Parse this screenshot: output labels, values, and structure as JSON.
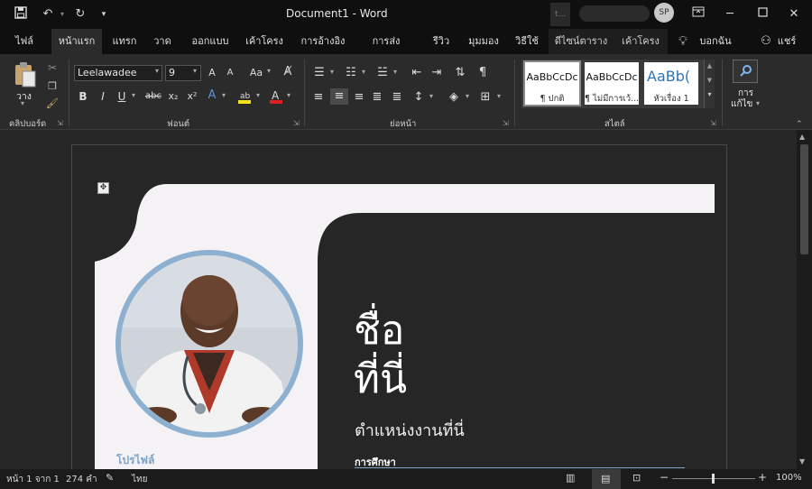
{
  "titlebar": {
    "doc_title": "Document1  -  Word",
    "account_initials": "SP",
    "account_hint": "t..."
  },
  "tabs": [
    {
      "label": "ไฟล์"
    },
    {
      "label": "หน้าแรก"
    },
    {
      "label": "แทรก"
    },
    {
      "label": "วาด"
    },
    {
      "label": "ออกแบบ"
    },
    {
      "label": "เค้าโครง"
    },
    {
      "label": "การอ้างอิง"
    },
    {
      "label": "การส่งจดหมาย"
    },
    {
      "label": "รีวิว"
    },
    {
      "label": "มุมมอง"
    },
    {
      "label": "วิธีใช้"
    },
    {
      "label": "ดีไซน์ตาราง"
    },
    {
      "label": "เค้าโครง"
    }
  ],
  "tell_me": "บอกฉัน",
  "share": "แชร์",
  "ribbon": {
    "clipboard": {
      "paste_label": "วาง",
      "group_label": "คลิปบอร์ด"
    },
    "font": {
      "font_name": "Leelawadee",
      "font_size": "9",
      "change_case": "Aa",
      "group_label": "ฟอนต์"
    },
    "paragraph": {
      "group_label": "ย่อหน้า"
    },
    "styles": {
      "group_label": "สไตล์",
      "items": [
        {
          "sample": "AaBbCcDc",
          "name": "¶ ปกติ"
        },
        {
          "sample": "AaBbCcDc",
          "name": "¶ ไม่มีการเว้..."
        },
        {
          "sample": "AaBb(",
          "name": "หัวเรื่อง 1"
        }
      ]
    },
    "editing": {
      "label_line1": "การ",
      "label_line2": "แก้ไข"
    }
  },
  "document": {
    "name_line1": "ชื่อ",
    "name_line2": "ที่นี่",
    "job_title": "ตำแหน่งงานที่นี่",
    "education_heading": "การศึกษา",
    "profile_heading": "โปรไฟล์"
  },
  "status": {
    "page": "หน้า 1 จาก 1",
    "words": "274 คำ",
    "language": "ไทย",
    "zoom": "100%",
    "zoom_level": 1.0
  },
  "colors": {
    "accent_blue": "#7fa3c8",
    "photo_ring": "#8db0d1",
    "panel_light": "#f4f2f4"
  }
}
